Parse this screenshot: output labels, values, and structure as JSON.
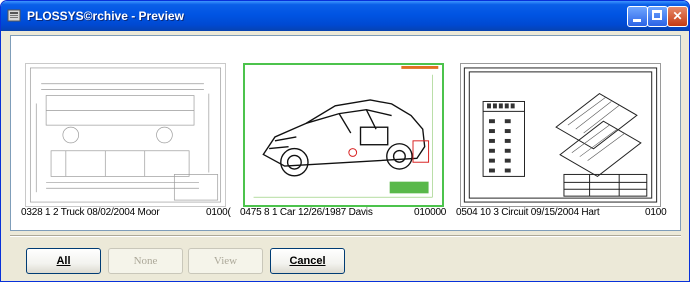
{
  "window": {
    "title": "PLOSSYS©rchive - Preview",
    "icons": [
      "app-icon",
      "minimize-icon",
      "maximize-icon",
      "close-icon"
    ]
  },
  "thumbnails": [
    {
      "caption": "0328 1 2 Truck 08/02/2004 Moor",
      "caption_cut": "0100(",
      "icon": "truck-drawing",
      "selected": false
    },
    {
      "caption": "0475 8 1 Car 12/26/1987 Davis",
      "caption_cut": "010000",
      "icon": "car-drawing",
      "selected": true
    },
    {
      "caption": "0504 10 3 Circuit 09/15/2004 Hart",
      "caption_cut": "0100",
      "icon": "circuit-drawing",
      "selected": false
    }
  ],
  "buttons": {
    "all": {
      "label": "All",
      "enabled": true
    },
    "none": {
      "label": "None",
      "enabled": false
    },
    "view": {
      "label": "View",
      "enabled": false
    },
    "cancel": {
      "label": "Cancel",
      "enabled": true
    }
  },
  "colors": {
    "titlebar": "#0054e3",
    "selection": "#4cc34c",
    "dialog": "#ece9d8"
  }
}
